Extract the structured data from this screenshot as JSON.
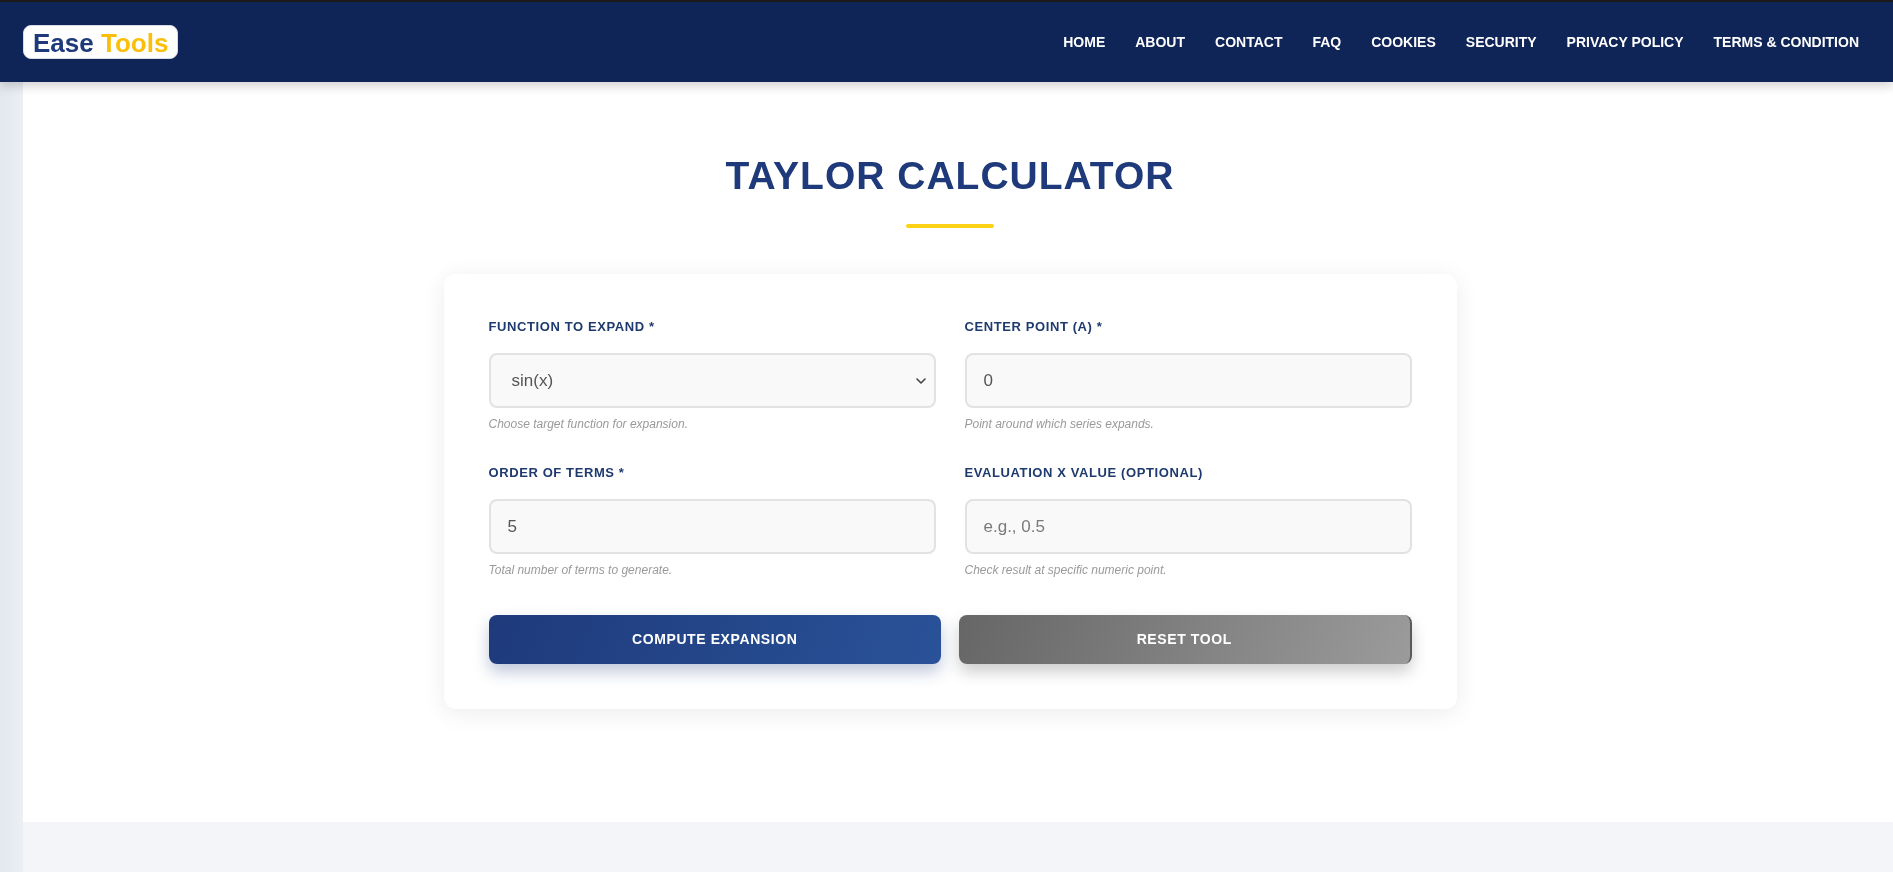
{
  "logo": {
    "words": [
      "Ease",
      "Tools"
    ]
  },
  "nav": [
    "HOME",
    "ABOUT",
    "CONTACT",
    "FAQ",
    "COOKIES",
    "SECURITY",
    "PRIVACY POLICY",
    "TERMS & CONDITION"
  ],
  "title": "TAYLOR CALCULATOR",
  "form": {
    "fields": [
      {
        "kind": "select",
        "label": "FUNCTION TO EXPAND *",
        "value": "sin(x)",
        "hint": "Choose target function for expansion."
      },
      {
        "kind": "input",
        "label": "CENTER POINT (A) *",
        "value": "0",
        "hint": "Point around which series expands."
      },
      {
        "kind": "input",
        "label": "ORDER OF TERMS *",
        "value": "5",
        "hint": "Total number of terms to generate."
      },
      {
        "kind": "input",
        "label": "EVALUATION X VALUE (OPTIONAL)",
        "placeholder": "e.g., 0.5",
        "hint": "Check result at specific numeric point."
      }
    ],
    "buttons": [
      {
        "kind": "primary",
        "label": "COMPUTE EXPANSION"
      },
      {
        "kind": "secondary",
        "label": "RESET TOOL"
      }
    ]
  }
}
